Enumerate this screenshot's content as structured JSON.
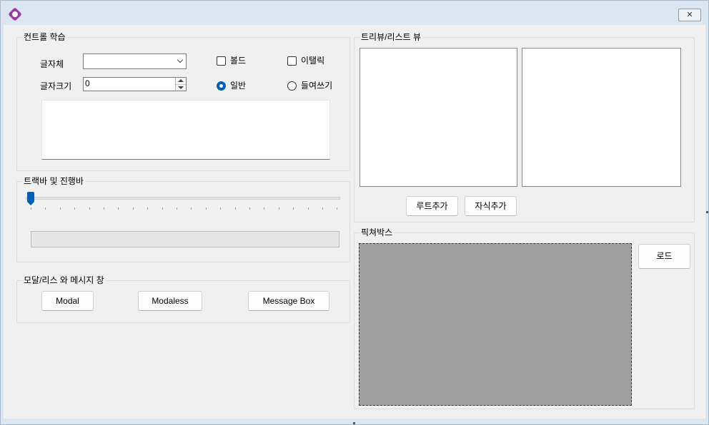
{
  "window": {
    "close_glyph": "✕"
  },
  "control_group": {
    "title": "컨트롤 학습",
    "font_label": "글자체",
    "font_combo_value": "",
    "size_label": "글자크기",
    "size_value": "0",
    "bold_label": "볼드",
    "bold_checked": false,
    "italic_label": "이탤릭",
    "italic_checked": false,
    "normal_label": "일반",
    "normal_selected": true,
    "indent_label": "들여쓰기",
    "indent_selected": false,
    "text_value": ""
  },
  "track_group": {
    "title": "트랙바 및 진행바",
    "trackbar_value": 0,
    "progress_percent": 0
  },
  "modal_group": {
    "title": "모달/리스 와 메시지 창",
    "modal_label": "Modal",
    "modaless_label": "Modaless",
    "message_label": "Message Box"
  },
  "tree_group": {
    "title": "트리뷰/리스트 뷰",
    "add_root_label": "루트추가",
    "add_child_label": "자식추가"
  },
  "picture_group": {
    "title": "픽쳐박스",
    "load_label": "로드"
  },
  "colors": {
    "accent": "#005fb8",
    "picture_bg": "#a0a0a0",
    "form_bg": "#f0f0f0",
    "frame": "#dbe6f3"
  }
}
